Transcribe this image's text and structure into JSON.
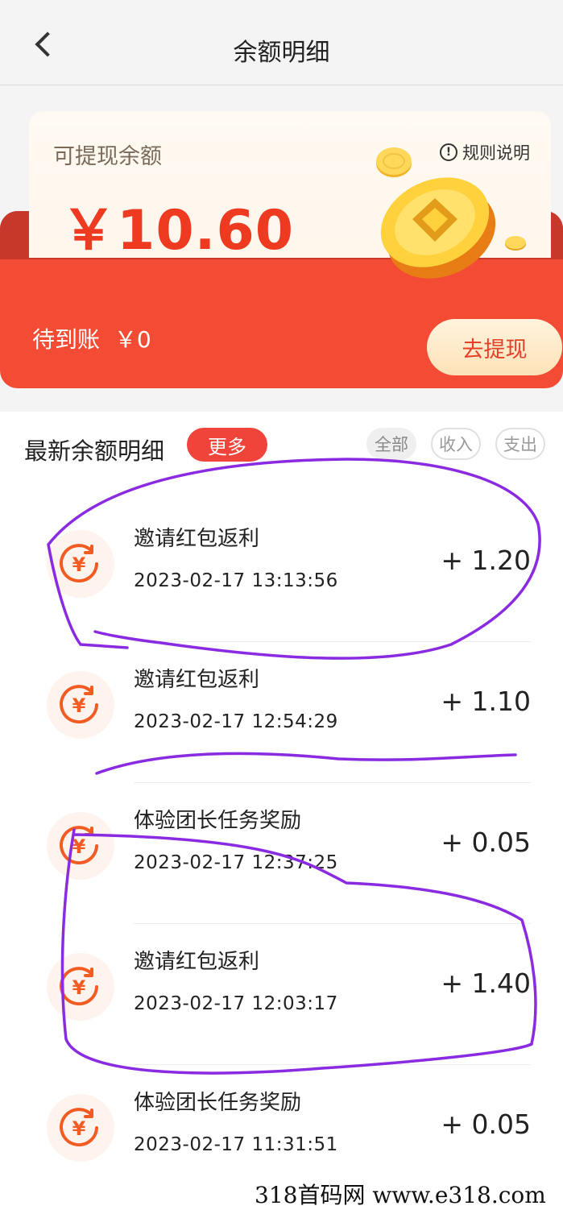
{
  "header": {
    "title": "余额明细"
  },
  "balance": {
    "label": "可提现余额",
    "amount": "￥10.60",
    "rules_label": "规则说明",
    "pending_label": "待到账",
    "pending_amount": "￥0",
    "withdraw_label": "去提现"
  },
  "list": {
    "title": "最新余额明细",
    "more_label": "更多",
    "filters": [
      "全部",
      "收入",
      "支出"
    ],
    "items": [
      {
        "name": "邀请红包返利",
        "time": "2023-02-17  13:13:56",
        "amount": "+ 1.20"
      },
      {
        "name": "邀请红包返利",
        "time": "2023-02-17  12:54:29",
        "amount": "+ 1.10"
      },
      {
        "name": "体验团长任务奖励",
        "time": "2023-02-17  12:37:25",
        "amount": "+ 0.05"
      },
      {
        "name": "邀请红包返利",
        "time": "2023-02-17  12:03:17",
        "amount": "+ 1.40"
      },
      {
        "name": "体验团长任务奖励",
        "time": "2023-02-17  11:31:51",
        "amount": "+ 0.05"
      }
    ]
  },
  "colors": {
    "accent": "#f44b34",
    "annotation": "#8a2be2"
  },
  "watermark": "318首码网 www.e318.com"
}
